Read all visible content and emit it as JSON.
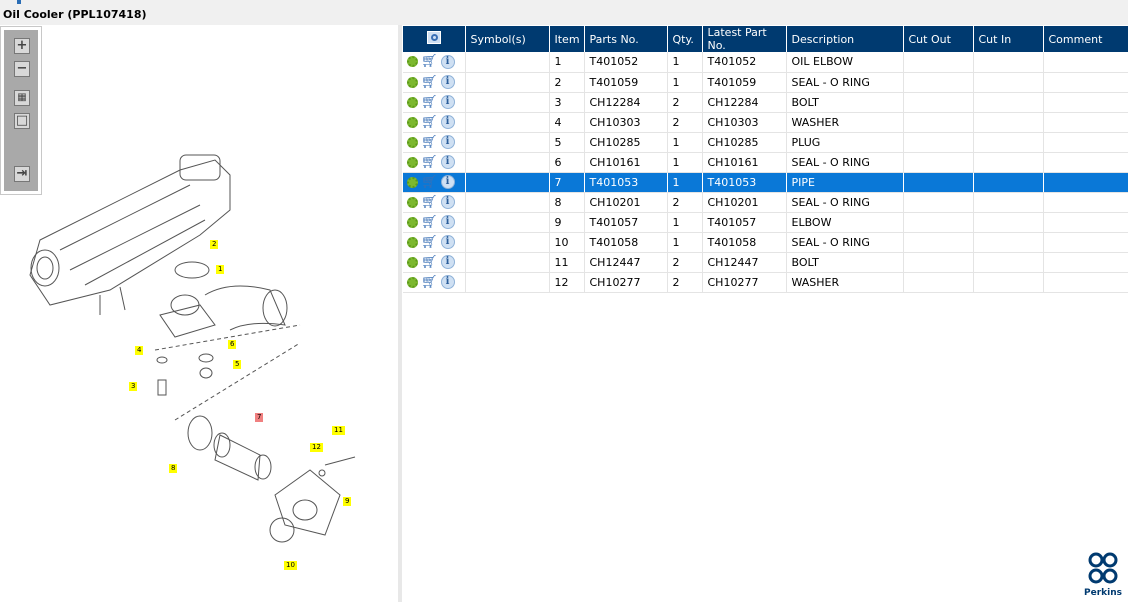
{
  "window": {
    "title": "Oil Cooler (PPL107418)"
  },
  "toolbar": {
    "zoom_in": "+",
    "zoom_out": "−",
    "fit": "▦",
    "frame": "□",
    "export": "⇥"
  },
  "diagram": {
    "callouts": [
      "2",
      "1",
      "4",
      "6",
      "5",
      "3",
      "7",
      "8",
      "12",
      "11",
      "9",
      "10"
    ],
    "selected": "7"
  },
  "table": {
    "headers": [
      "",
      "Symbol(s)",
      "Item",
      "Parts No.",
      "Qty.",
      "Latest Part No.",
      "Description",
      "Cut Out",
      "Cut In",
      "Comment"
    ],
    "selected_item": "7",
    "rows": [
      {
        "item": "1",
        "part": "T401052",
        "qty": "1",
        "latest": "T401052",
        "desc": "OIL ELBOW"
      },
      {
        "item": "2",
        "part": "T401059",
        "qty": "1",
        "latest": "T401059",
        "desc": "SEAL - O RING"
      },
      {
        "item": "3",
        "part": "CH12284",
        "qty": "2",
        "latest": "CH12284",
        "desc": "BOLT"
      },
      {
        "item": "4",
        "part": "CH10303",
        "qty": "2",
        "latest": "CH10303",
        "desc": "WASHER"
      },
      {
        "item": "5",
        "part": "CH10285",
        "qty": "1",
        "latest": "CH10285",
        "desc": "PLUG"
      },
      {
        "item": "6",
        "part": "CH10161",
        "qty": "1",
        "latest": "CH10161",
        "desc": "SEAL - O RING"
      },
      {
        "item": "7",
        "part": "T401053",
        "qty": "1",
        "latest": "T401053",
        "desc": "PIPE"
      },
      {
        "item": "8",
        "part": "CH10201",
        "qty": "2",
        "latest": "CH10201",
        "desc": "SEAL - O RING"
      },
      {
        "item": "9",
        "part": "T401057",
        "qty": "1",
        "latest": "T401057",
        "desc": "ELBOW"
      },
      {
        "item": "10",
        "part": "T401058",
        "qty": "1",
        "latest": "T401058",
        "desc": "SEAL - O RING"
      },
      {
        "item": "11",
        "part": "CH12447",
        "qty": "2",
        "latest": "CH12447",
        "desc": "BOLT"
      },
      {
        "item": "12",
        "part": "CH10277",
        "qty": "2",
        "latest": "CH10277",
        "desc": "WASHER"
      }
    ]
  },
  "brand": {
    "name": "Perkins",
    "color": "#003a70"
  },
  "colors": {
    "header": "#003a70",
    "selected_row": "#0a78d7",
    "callout": "#ffff00",
    "callout_selected": "#f08080"
  }
}
